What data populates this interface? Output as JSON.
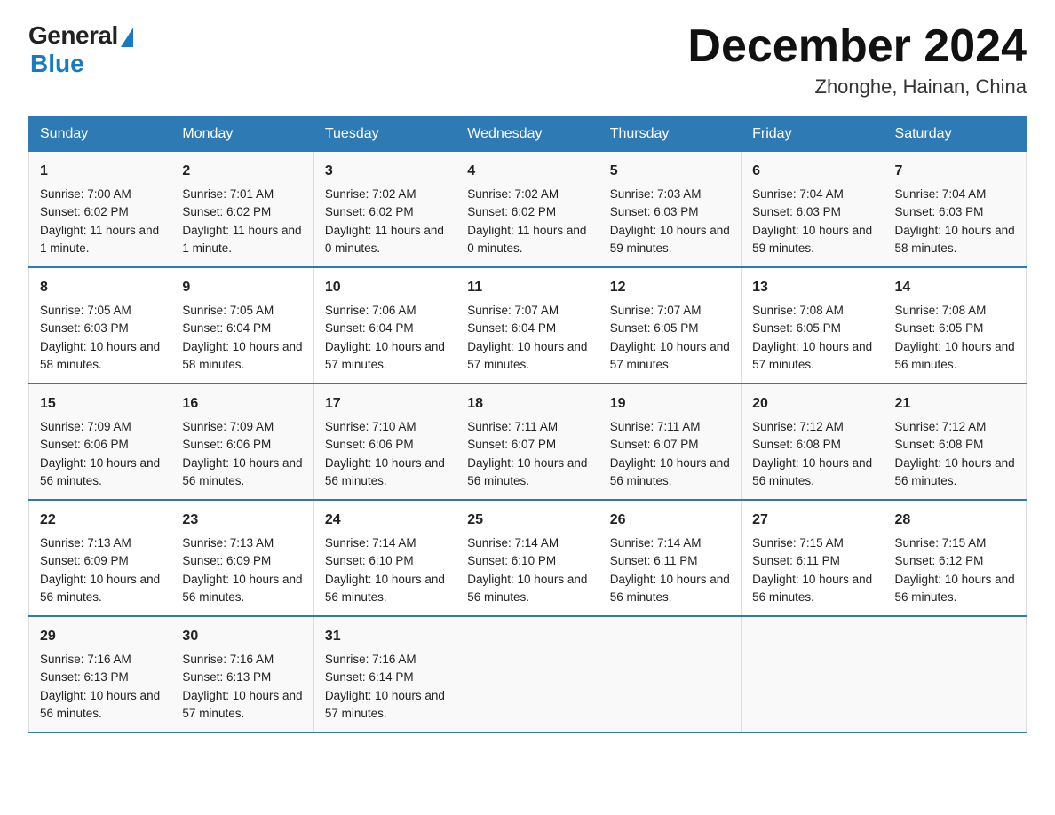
{
  "logo": {
    "general": "General",
    "blue": "Blue"
  },
  "title": "December 2024",
  "location": "Zhonghe, Hainan, China",
  "days_header": [
    "Sunday",
    "Monday",
    "Tuesday",
    "Wednesday",
    "Thursday",
    "Friday",
    "Saturday"
  ],
  "weeks": [
    [
      {
        "day": "1",
        "sunrise": "7:00 AM",
        "sunset": "6:02 PM",
        "daylight": "11 hours and 1 minute."
      },
      {
        "day": "2",
        "sunrise": "7:01 AM",
        "sunset": "6:02 PM",
        "daylight": "11 hours and 1 minute."
      },
      {
        "day": "3",
        "sunrise": "7:02 AM",
        "sunset": "6:02 PM",
        "daylight": "11 hours and 0 minutes."
      },
      {
        "day": "4",
        "sunrise": "7:02 AM",
        "sunset": "6:02 PM",
        "daylight": "11 hours and 0 minutes."
      },
      {
        "day": "5",
        "sunrise": "7:03 AM",
        "sunset": "6:03 PM",
        "daylight": "10 hours and 59 minutes."
      },
      {
        "day": "6",
        "sunrise": "7:04 AM",
        "sunset": "6:03 PM",
        "daylight": "10 hours and 59 minutes."
      },
      {
        "day": "7",
        "sunrise": "7:04 AM",
        "sunset": "6:03 PM",
        "daylight": "10 hours and 58 minutes."
      }
    ],
    [
      {
        "day": "8",
        "sunrise": "7:05 AM",
        "sunset": "6:03 PM",
        "daylight": "10 hours and 58 minutes."
      },
      {
        "day": "9",
        "sunrise": "7:05 AM",
        "sunset": "6:04 PM",
        "daylight": "10 hours and 58 minutes."
      },
      {
        "day": "10",
        "sunrise": "7:06 AM",
        "sunset": "6:04 PM",
        "daylight": "10 hours and 57 minutes."
      },
      {
        "day": "11",
        "sunrise": "7:07 AM",
        "sunset": "6:04 PM",
        "daylight": "10 hours and 57 minutes."
      },
      {
        "day": "12",
        "sunrise": "7:07 AM",
        "sunset": "6:05 PM",
        "daylight": "10 hours and 57 minutes."
      },
      {
        "day": "13",
        "sunrise": "7:08 AM",
        "sunset": "6:05 PM",
        "daylight": "10 hours and 57 minutes."
      },
      {
        "day": "14",
        "sunrise": "7:08 AM",
        "sunset": "6:05 PM",
        "daylight": "10 hours and 56 minutes."
      }
    ],
    [
      {
        "day": "15",
        "sunrise": "7:09 AM",
        "sunset": "6:06 PM",
        "daylight": "10 hours and 56 minutes."
      },
      {
        "day": "16",
        "sunrise": "7:09 AM",
        "sunset": "6:06 PM",
        "daylight": "10 hours and 56 minutes."
      },
      {
        "day": "17",
        "sunrise": "7:10 AM",
        "sunset": "6:06 PM",
        "daylight": "10 hours and 56 minutes."
      },
      {
        "day": "18",
        "sunrise": "7:11 AM",
        "sunset": "6:07 PM",
        "daylight": "10 hours and 56 minutes."
      },
      {
        "day": "19",
        "sunrise": "7:11 AM",
        "sunset": "6:07 PM",
        "daylight": "10 hours and 56 minutes."
      },
      {
        "day": "20",
        "sunrise": "7:12 AM",
        "sunset": "6:08 PM",
        "daylight": "10 hours and 56 minutes."
      },
      {
        "day": "21",
        "sunrise": "7:12 AM",
        "sunset": "6:08 PM",
        "daylight": "10 hours and 56 minutes."
      }
    ],
    [
      {
        "day": "22",
        "sunrise": "7:13 AM",
        "sunset": "6:09 PM",
        "daylight": "10 hours and 56 minutes."
      },
      {
        "day": "23",
        "sunrise": "7:13 AM",
        "sunset": "6:09 PM",
        "daylight": "10 hours and 56 minutes."
      },
      {
        "day": "24",
        "sunrise": "7:14 AM",
        "sunset": "6:10 PM",
        "daylight": "10 hours and 56 minutes."
      },
      {
        "day": "25",
        "sunrise": "7:14 AM",
        "sunset": "6:10 PM",
        "daylight": "10 hours and 56 minutes."
      },
      {
        "day": "26",
        "sunrise": "7:14 AM",
        "sunset": "6:11 PM",
        "daylight": "10 hours and 56 minutes."
      },
      {
        "day": "27",
        "sunrise": "7:15 AM",
        "sunset": "6:11 PM",
        "daylight": "10 hours and 56 minutes."
      },
      {
        "day": "28",
        "sunrise": "7:15 AM",
        "sunset": "6:12 PM",
        "daylight": "10 hours and 56 minutes."
      }
    ],
    [
      {
        "day": "29",
        "sunrise": "7:16 AM",
        "sunset": "6:13 PM",
        "daylight": "10 hours and 56 minutes."
      },
      {
        "day": "30",
        "sunrise": "7:16 AM",
        "sunset": "6:13 PM",
        "daylight": "10 hours and 57 minutes."
      },
      {
        "day": "31",
        "sunrise": "7:16 AM",
        "sunset": "6:14 PM",
        "daylight": "10 hours and 57 minutes."
      },
      null,
      null,
      null,
      null
    ]
  ]
}
